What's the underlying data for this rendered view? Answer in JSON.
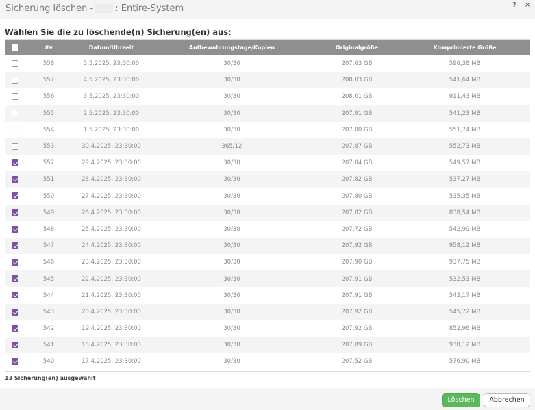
{
  "dialog": {
    "title_prefix": "Sicherung löschen -",
    "title_suffix": ": Entire-System",
    "help_label": "?",
    "close_label": "×"
  },
  "section_title": "Wählen Sie die zu löschende(n) Sicherung(en) aus:",
  "table": {
    "headers": {
      "number": "#",
      "sort_indicator": "▼",
      "datetime": "Datum/Uhrzeit",
      "retention": "Aufbewahrungstage/Kopien",
      "original_size": "Originalgröße",
      "compressed_size": "Komprimierte Größe"
    },
    "rows": [
      {
        "checked": false,
        "number": "558",
        "datetime": "5.5.2025, 23:30:00",
        "retention": "30/30",
        "original": "207,63 GB",
        "compressed": "596,38 MB"
      },
      {
        "checked": false,
        "number": "557",
        "datetime": "4.5.2025, 23:30:00",
        "retention": "30/30",
        "original": "208,03 GB",
        "compressed": "541,64 MB"
      },
      {
        "checked": false,
        "number": "556",
        "datetime": "3.5.2025, 23:30:00",
        "retention": "30/30",
        "original": "208,01 GB",
        "compressed": "911,43 MB"
      },
      {
        "checked": false,
        "number": "555",
        "datetime": "2.5.2025, 23:30:00",
        "retention": "30/30",
        "original": "207,91 GB",
        "compressed": "541,23 MB"
      },
      {
        "checked": false,
        "number": "554",
        "datetime": "1.5.2025, 23:30:00",
        "retention": "30/30",
        "original": "207,80 GB",
        "compressed": "551,74 MB"
      },
      {
        "checked": false,
        "number": "553",
        "datetime": "30.4.2025, 23:30:00",
        "retention": "365/12",
        "original": "207,87 GB",
        "compressed": "552,73 MB"
      },
      {
        "checked": true,
        "number": "552",
        "datetime": "29.4.2025, 23:30:00",
        "retention": "30/30",
        "original": "207,84 GB",
        "compressed": "549,57 MB"
      },
      {
        "checked": true,
        "number": "551",
        "datetime": "28.4.2025, 23:30:00",
        "retention": "30/30",
        "original": "207,82 GB",
        "compressed": "537,27 MB"
      },
      {
        "checked": true,
        "number": "550",
        "datetime": "27.4.2025, 23:30:00",
        "retention": "30/30",
        "original": "207,80 GB",
        "compressed": "535,35 MB"
      },
      {
        "checked": true,
        "number": "549",
        "datetime": "26.4.2025, 23:30:00",
        "retention": "30/30",
        "original": "207,82 GB",
        "compressed": "838,54 MB"
      },
      {
        "checked": true,
        "number": "548",
        "datetime": "25.4.2025, 23:30:00",
        "retention": "30/30",
        "original": "207,72 GB",
        "compressed": "542,99 MB"
      },
      {
        "checked": true,
        "number": "547",
        "datetime": "24.4.2025, 23:30:00",
        "retention": "30/30",
        "original": "207,92 GB",
        "compressed": "958,12 MB"
      },
      {
        "checked": true,
        "number": "546",
        "datetime": "23.4.2025, 23:30:00",
        "retention": "30/30",
        "original": "207,90 GB",
        "compressed": "937,75 MB"
      },
      {
        "checked": true,
        "number": "545",
        "datetime": "22.4.2025, 23:30:00",
        "retention": "30/30",
        "original": "207,91 GB",
        "compressed": "532,53 MB"
      },
      {
        "checked": true,
        "number": "544",
        "datetime": "21.4.2025, 23:30:00",
        "retention": "30/30",
        "original": "207,91 GB",
        "compressed": "543,17 MB"
      },
      {
        "checked": true,
        "number": "543",
        "datetime": "20.4.2025, 23:30:00",
        "retention": "30/30",
        "original": "207,92 GB",
        "compressed": "545,72 MB"
      },
      {
        "checked": true,
        "number": "542",
        "datetime": "19.4.2025, 23:30:00",
        "retention": "30/30",
        "original": "207,92 GB",
        "compressed": "852,96 MB"
      },
      {
        "checked": true,
        "number": "541",
        "datetime": "18.4.2025, 23:30:00",
        "retention": "30/30",
        "original": "207,89 GB",
        "compressed": "938,12 MB"
      },
      {
        "checked": true,
        "number": "540",
        "datetime": "17.4.2025, 23:30:00",
        "retention": "30/30",
        "original": "207,52 GB",
        "compressed": "576,90 MB"
      }
    ]
  },
  "status_text": "13 Sicherung(en) ausgewählt",
  "buttons": {
    "delete": "Löschen",
    "cancel": "Abbrechen"
  },
  "colors": {
    "checkbox_checked": "#7b4fa3",
    "header_bg": "#8f8f8f",
    "delete_button": "#5cb85c"
  }
}
